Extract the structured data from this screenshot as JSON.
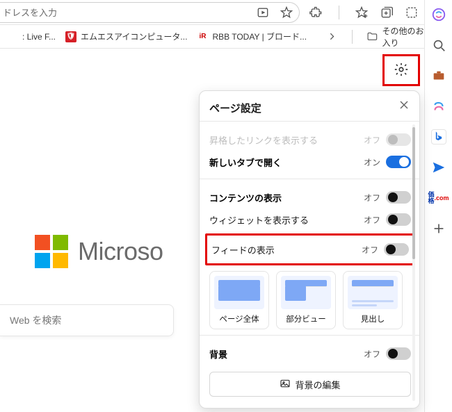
{
  "addressbar": {
    "placeholder": "ドレスを入力"
  },
  "bookmarks": {
    "items": [
      {
        "label": ": Live F..."
      },
      {
        "label": "エムエスアイコンピュータ..."
      },
      {
        "label": "RBB TODAY | ブロード..."
      }
    ],
    "other_label": "その他のお気に入り"
  },
  "logo": {
    "brand": "Microso"
  },
  "search": {
    "placeholder": "Web を検索"
  },
  "panel": {
    "title": "ページ設定",
    "rows": {
      "promoted_links": {
        "label": "昇格したリンクを表示する",
        "state": "オフ"
      },
      "open_new_tab": {
        "label": "新しいタブで開く",
        "state": "オン"
      },
      "content_display": {
        "label": "コンテンツの表示",
        "state": "オフ"
      },
      "show_widgets": {
        "label": "ウィジェットを表示する",
        "state": "オフ"
      },
      "show_feed": {
        "label": "フィードの表示",
        "state": "オフ"
      },
      "background": {
        "label": "背景",
        "state": "オフ"
      }
    },
    "tiles": {
      "full": "ページ全体",
      "partial": "部分ビュー",
      "headline": "見出し"
    },
    "background_edit": "背景の編集"
  },
  "sidebar_text": {
    "kakaku": "価格"
  }
}
